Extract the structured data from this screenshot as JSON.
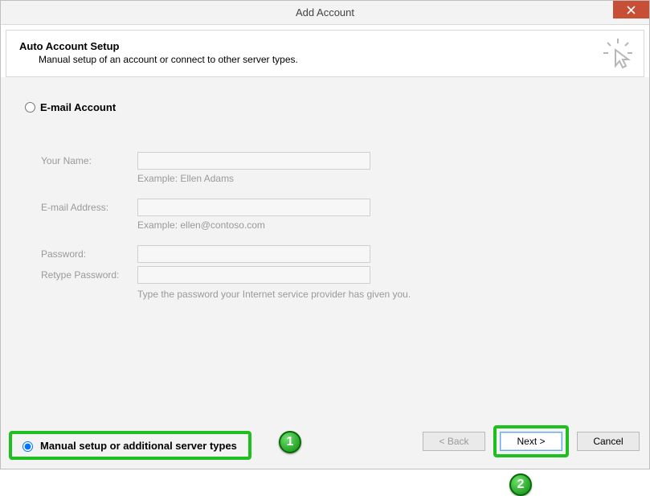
{
  "window": {
    "title": "Add Account"
  },
  "header": {
    "title": "Auto Account Setup",
    "subtitle": "Manual setup of an account or connect to other server types."
  },
  "radios": {
    "email_label": "E-mail Account",
    "manual_label": "Manual setup or additional server types",
    "selected": "manual"
  },
  "fields": {
    "name_label": "Your Name:",
    "name_hint": "Example: Ellen Adams",
    "email_label": "E-mail Address:",
    "email_hint": "Example: ellen@contoso.com",
    "password_label": "Password:",
    "retype_label": "Retype Password:",
    "password_hint": "Type the password your Internet service provider has given you."
  },
  "buttons": {
    "back": "< Back",
    "next": "Next >",
    "cancel": "Cancel"
  },
  "markers": {
    "one": "1",
    "two": "2"
  }
}
